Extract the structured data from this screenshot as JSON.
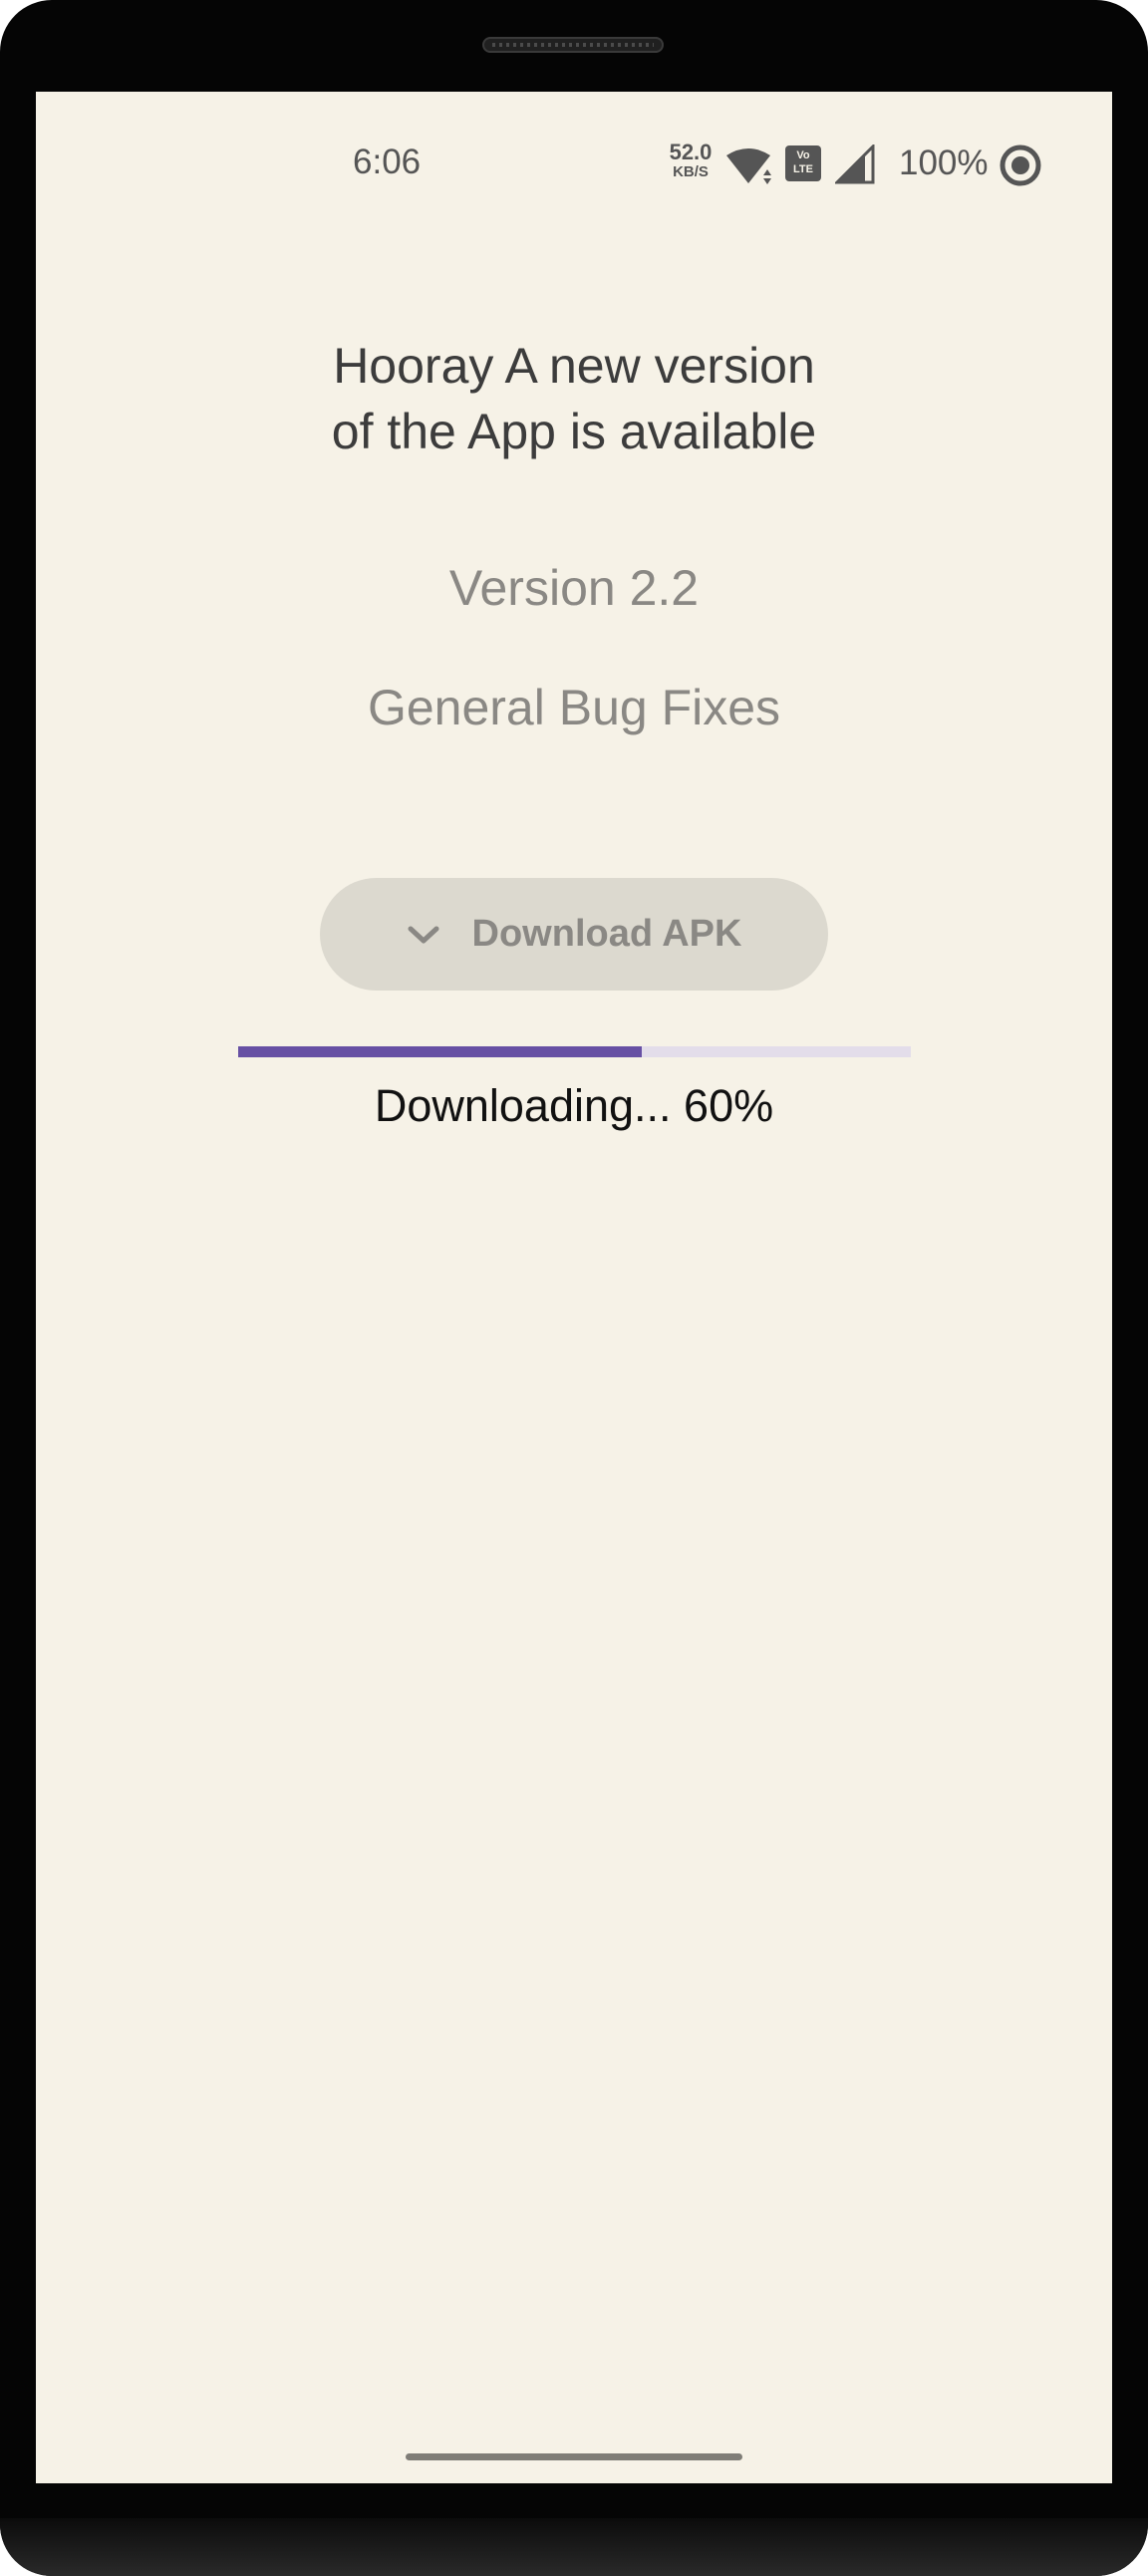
{
  "status_bar": {
    "time": "6:06",
    "network_speed_value": "52.0",
    "network_speed_unit": "KB/S",
    "volte_top": "Vo",
    "volte_bottom": "LTE",
    "battery": "100%",
    "icons": [
      "wifi-icon",
      "volte-icon",
      "signal-icon",
      "record-icon"
    ]
  },
  "update": {
    "headline_line1": "Hooray A new version",
    "headline_line2": "of the App is available",
    "version": "Version 2.2",
    "notes": "General Bug Fixes",
    "button_label": "Download APK",
    "button_icon": "chevron-down-icon",
    "progress_text": "Downloading... 60%",
    "progress_fraction": 0.6
  },
  "colors": {
    "screen_background": "#f6f2e7",
    "accent": "#6750a4",
    "progress_track": "#e3ddea",
    "button_background": "#dcd9cf",
    "muted_text": "#8a8884"
  }
}
